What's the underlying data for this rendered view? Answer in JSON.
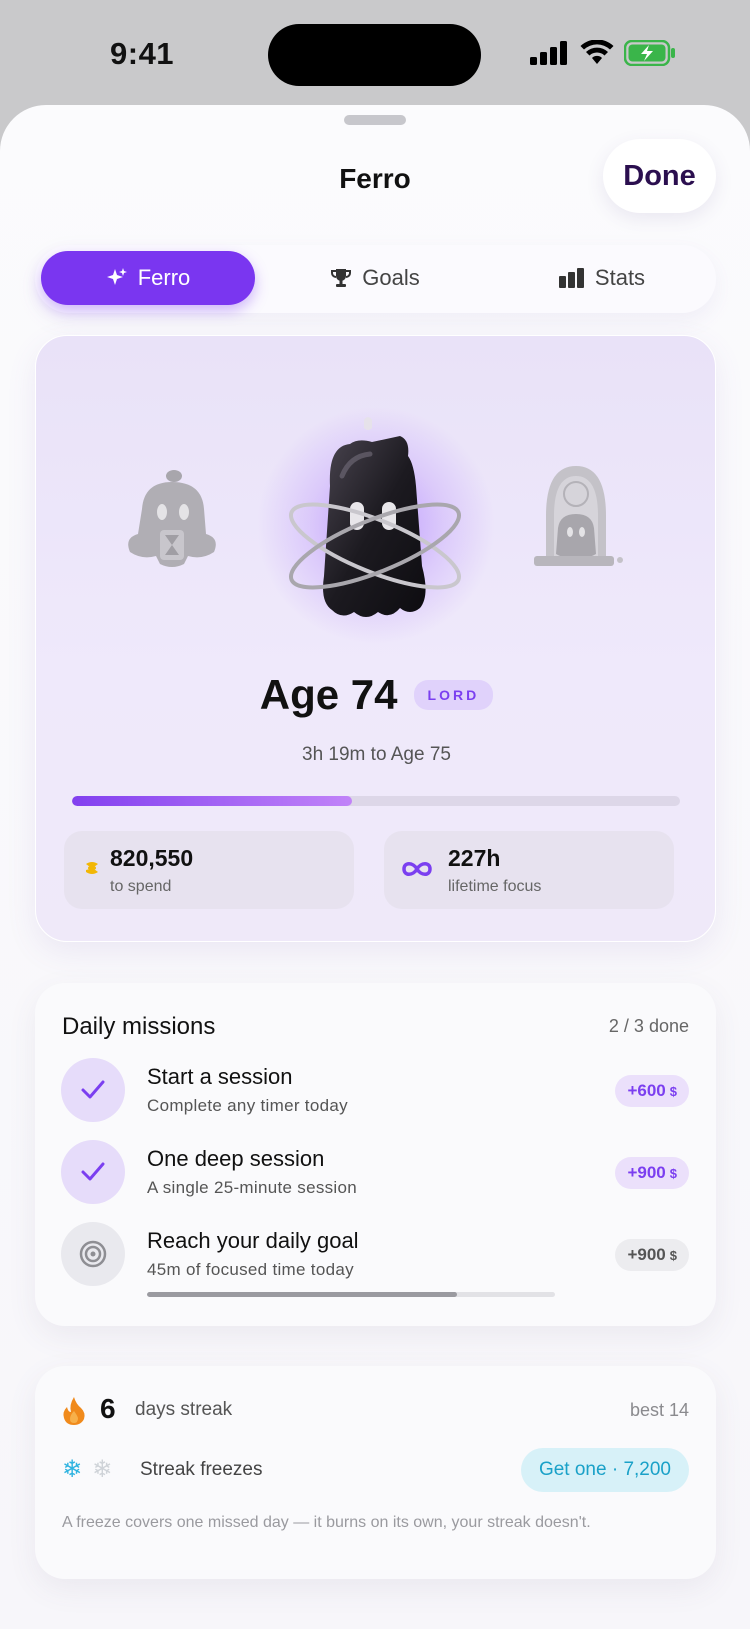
{
  "status_bar": {
    "time": "9:41"
  },
  "sheet": {
    "title": "Ferro",
    "done_label": "Done"
  },
  "tabs": [
    {
      "label": "Ferro",
      "icon": "sparkles-icon",
      "active": true
    },
    {
      "label": "Goals",
      "icon": "trophy-icon",
      "active": false
    },
    {
      "label": "Stats",
      "icon": "bar-chart-icon",
      "active": false
    }
  ],
  "hero": {
    "age": "Age 74",
    "rank": "LORD",
    "next_age": "3h 19m to Age 75",
    "progress_fraction": 0.46,
    "coins": {
      "value": "820,550",
      "label": "to spend"
    },
    "focus": {
      "value": "227h",
      "label": "lifetime focus"
    }
  },
  "missions": {
    "title": "Daily missions",
    "count": "2 / 3 done",
    "items": [
      {
        "name": "Start a session",
        "desc": "Complete any timer today",
        "reward": "+600",
        "done": true
      },
      {
        "name": "One deep session",
        "desc": "A single 25-minute session",
        "reward": "+900",
        "done": true
      },
      {
        "name": "Reach your daily goal",
        "desc": "45m of focused time today",
        "reward": "+900",
        "done": false,
        "progress_fraction": 0.76
      }
    ]
  },
  "streak": {
    "days": "6",
    "label": "days streak",
    "best": "best 14",
    "freeze_label": "Streak freezes",
    "get_one": "Get one · 7,200",
    "note": "A freeze covers one missed day — it burns on its own, your streak doesn't."
  },
  "colors": {
    "accent": "#7a36f0",
    "accent_light": "#e6dcfa",
    "ice": "#2fb3e0",
    "fire": "#f08a1c"
  }
}
